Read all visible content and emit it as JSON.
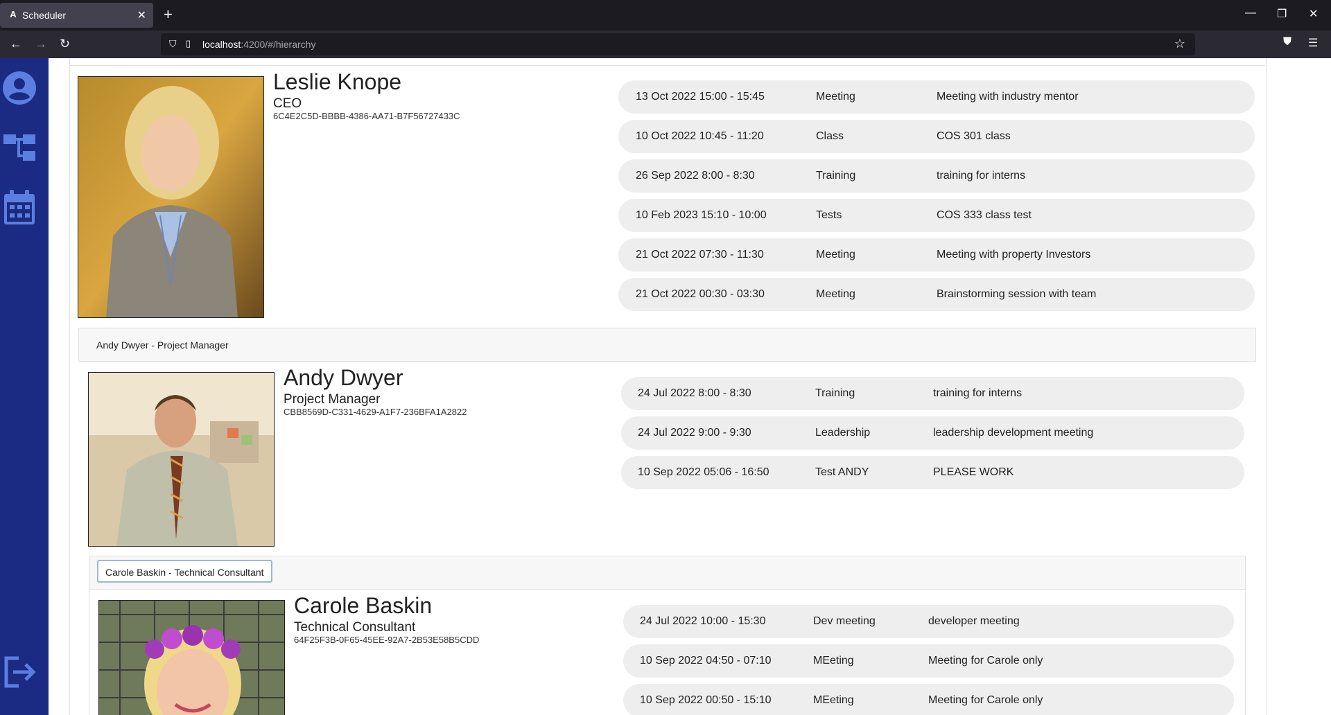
{
  "browser": {
    "tab_title": "Scheduler",
    "tab_favicon": "A",
    "url_host": "localhost",
    "url_rest": ":4200/#/hierarchy"
  },
  "sidebar": {
    "items": [
      {
        "name": "profile-icon"
      },
      {
        "name": "hierarchy-icon"
      },
      {
        "name": "calendar-icon"
      },
      {
        "name": "logout-icon"
      }
    ],
    "accent_color": "#1b2a82",
    "icon_color": "#5b7fe0"
  },
  "people": [
    {
      "name": "Leslie Knope",
      "role": "CEO",
      "id": "6C4E2C5D-BBBB-4386-AA71-B7F56727433C",
      "events": [
        {
          "time": "13 Oct 2022 15:00 - 15:45",
          "type": "Meeting",
          "desc": "Meeting with industry mentor"
        },
        {
          "time": "10 Oct 2022 10:45 - 11:20",
          "type": "Class",
          "desc": "COS 301 class"
        },
        {
          "time": "26 Sep 2022 8:00 - 8:30",
          "type": "Training",
          "desc": "training for interns"
        },
        {
          "time": "10 Feb 2023 15:10 - 10:00",
          "type": "Tests",
          "desc": "COS 333 class test"
        },
        {
          "time": "21 Oct 2022 07:30 - 11:30",
          "type": "Meeting",
          "desc": "Meeting with property Investors"
        },
        {
          "time": "21 Oct 2022 00:30 - 03:30",
          "type": "Meeting",
          "desc": "Brainstorming session with team"
        }
      ]
    },
    {
      "group_label": "Andy Dwyer - Project Manager",
      "name": "Andy Dwyer",
      "role": "Project Manager",
      "id": "CBB8569D-C331-4629-A1F7-236BFA1A2822",
      "events": [
        {
          "time": "24 Jul 2022 8:00 - 8:30",
          "type": "Training",
          "desc": "training for interns"
        },
        {
          "time": "24 Jul 2022 9:00 - 9:30",
          "type": "Leadership",
          "desc": "leadership development meeting"
        },
        {
          "time": "10 Sep 2022 05:06 - 16:50",
          "type": "Test ANDY",
          "desc": "PLEASE WORK"
        }
      ]
    },
    {
      "group_label": "Carole Baskin - Technical Consultant",
      "name": "Carole Baskin",
      "role": "Technical Consultant",
      "id": "64F25F3B-0F65-45EE-92A7-2B53E58B5CDD",
      "events": [
        {
          "time": "24 Jul 2022 10:00 - 15:30",
          "type": "Dev meeting",
          "desc": "developer meeting"
        },
        {
          "time": "10 Sep 2022 04:50 - 07:10",
          "type": "MEeting",
          "desc": "Meeting for Carole only"
        },
        {
          "time": "10 Sep 2022 00:50 - 15:10",
          "type": "MEeting",
          "desc": "Meeting for Carole only"
        }
      ]
    }
  ]
}
